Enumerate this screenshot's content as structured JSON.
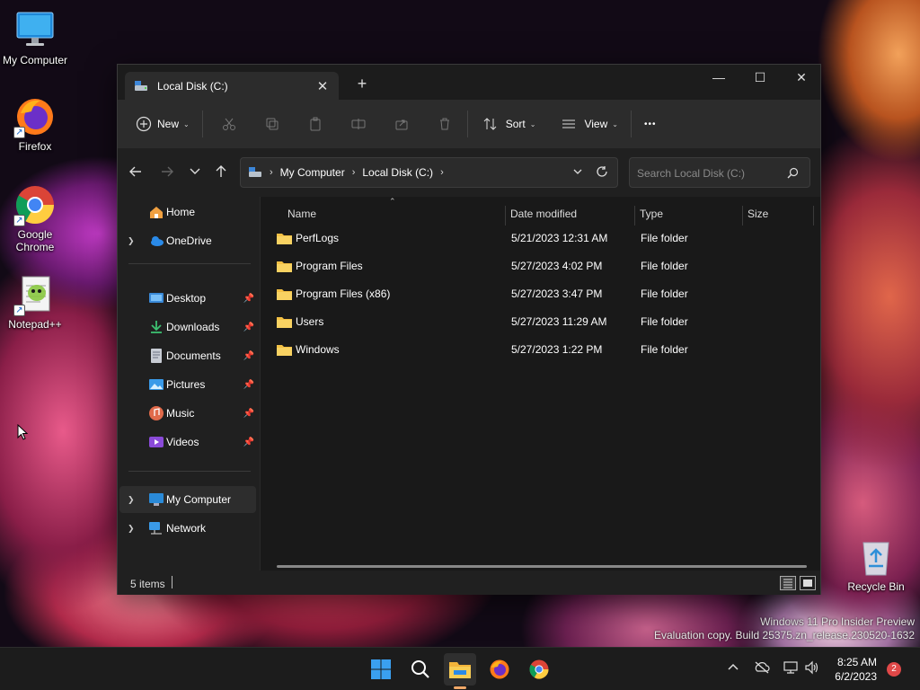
{
  "desktop": {
    "icons": [
      {
        "label": "My Computer"
      },
      {
        "label": "Firefox"
      },
      {
        "label": "Google Chrome"
      },
      {
        "label": "Notepad++"
      }
    ],
    "recycle_bin": "Recycle Bin"
  },
  "window": {
    "tab_title": "Local Disk (C:)",
    "tab_close": "✕",
    "new_tab": "+",
    "controls": {
      "minimize": "—",
      "maximize": "☐",
      "close": "✕"
    },
    "toolbar": {
      "new_label": "New",
      "sort_label": "Sort",
      "view_label": "View",
      "more_label": "•••"
    },
    "address": {
      "crumbs": [
        "My Computer",
        "Local Disk (C:)"
      ],
      "search_placeholder": "Search Local Disk (C:)"
    },
    "nav": {
      "home": "Home",
      "onedrive": "OneDrive",
      "quick": [
        "Desktop",
        "Downloads",
        "Documents",
        "Pictures",
        "Music",
        "Videos"
      ],
      "my_computer": "My Computer",
      "network": "Network"
    },
    "columns": {
      "name": "Name",
      "date": "Date modified",
      "type": "Type",
      "size": "Size"
    },
    "files": [
      {
        "name": "PerfLogs",
        "date": "5/21/2023 12:31 AM",
        "type": "File folder"
      },
      {
        "name": "Program Files",
        "date": "5/27/2023 4:02 PM",
        "type": "File folder"
      },
      {
        "name": "Program Files (x86)",
        "date": "5/27/2023 3:47 PM",
        "type": "File folder"
      },
      {
        "name": "Users",
        "date": "5/27/2023 11:29 AM",
        "type": "File folder"
      },
      {
        "name": "Windows",
        "date": "5/27/2023 1:22 PM",
        "type": "File folder"
      }
    ],
    "status": "5 items"
  },
  "watermark": {
    "line1": "Windows 11 Pro Insider Preview",
    "line2": "Evaluation copy. Build 25375.zn_release.230520-1632"
  },
  "taskbar": {
    "time": "8:25 AM",
    "date": "6/2/2023",
    "notifications": "2"
  },
  "colors": {
    "accent": "#0078d4",
    "folder": "#f3c044",
    "window_bg": "#202020",
    "toolbar_bg": "#2c2c2c"
  }
}
